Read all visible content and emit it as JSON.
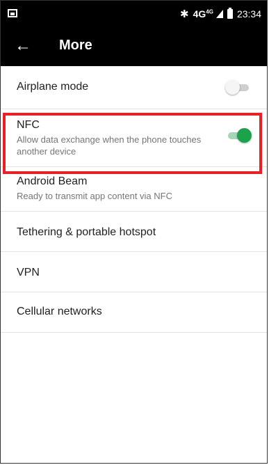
{
  "status_bar": {
    "network": "4G",
    "network_sub": "4G",
    "time": "23:34",
    "icons": [
      "notification-icon",
      "bluetooth-icon",
      "signal-icon",
      "battery-icon"
    ]
  },
  "app_bar": {
    "back_icon": "arrow-left-icon",
    "title": "More"
  },
  "settings": {
    "airplane": {
      "label": "Airplane mode",
      "enabled": false
    },
    "nfc": {
      "label": "NFC",
      "summary": "Allow data exchange when the phone touches another device",
      "enabled": true
    },
    "beam": {
      "label": "Android Beam",
      "summary": "Ready to transmit app content via NFC"
    },
    "tethering": {
      "label": "Tethering & portable hotspot"
    },
    "vpn": {
      "label": "VPN"
    },
    "cellular": {
      "label": "Cellular networks"
    }
  },
  "colors": {
    "accent_on": "#1aa34a",
    "highlight_box": "#e82127",
    "toolbar": "#000000"
  }
}
